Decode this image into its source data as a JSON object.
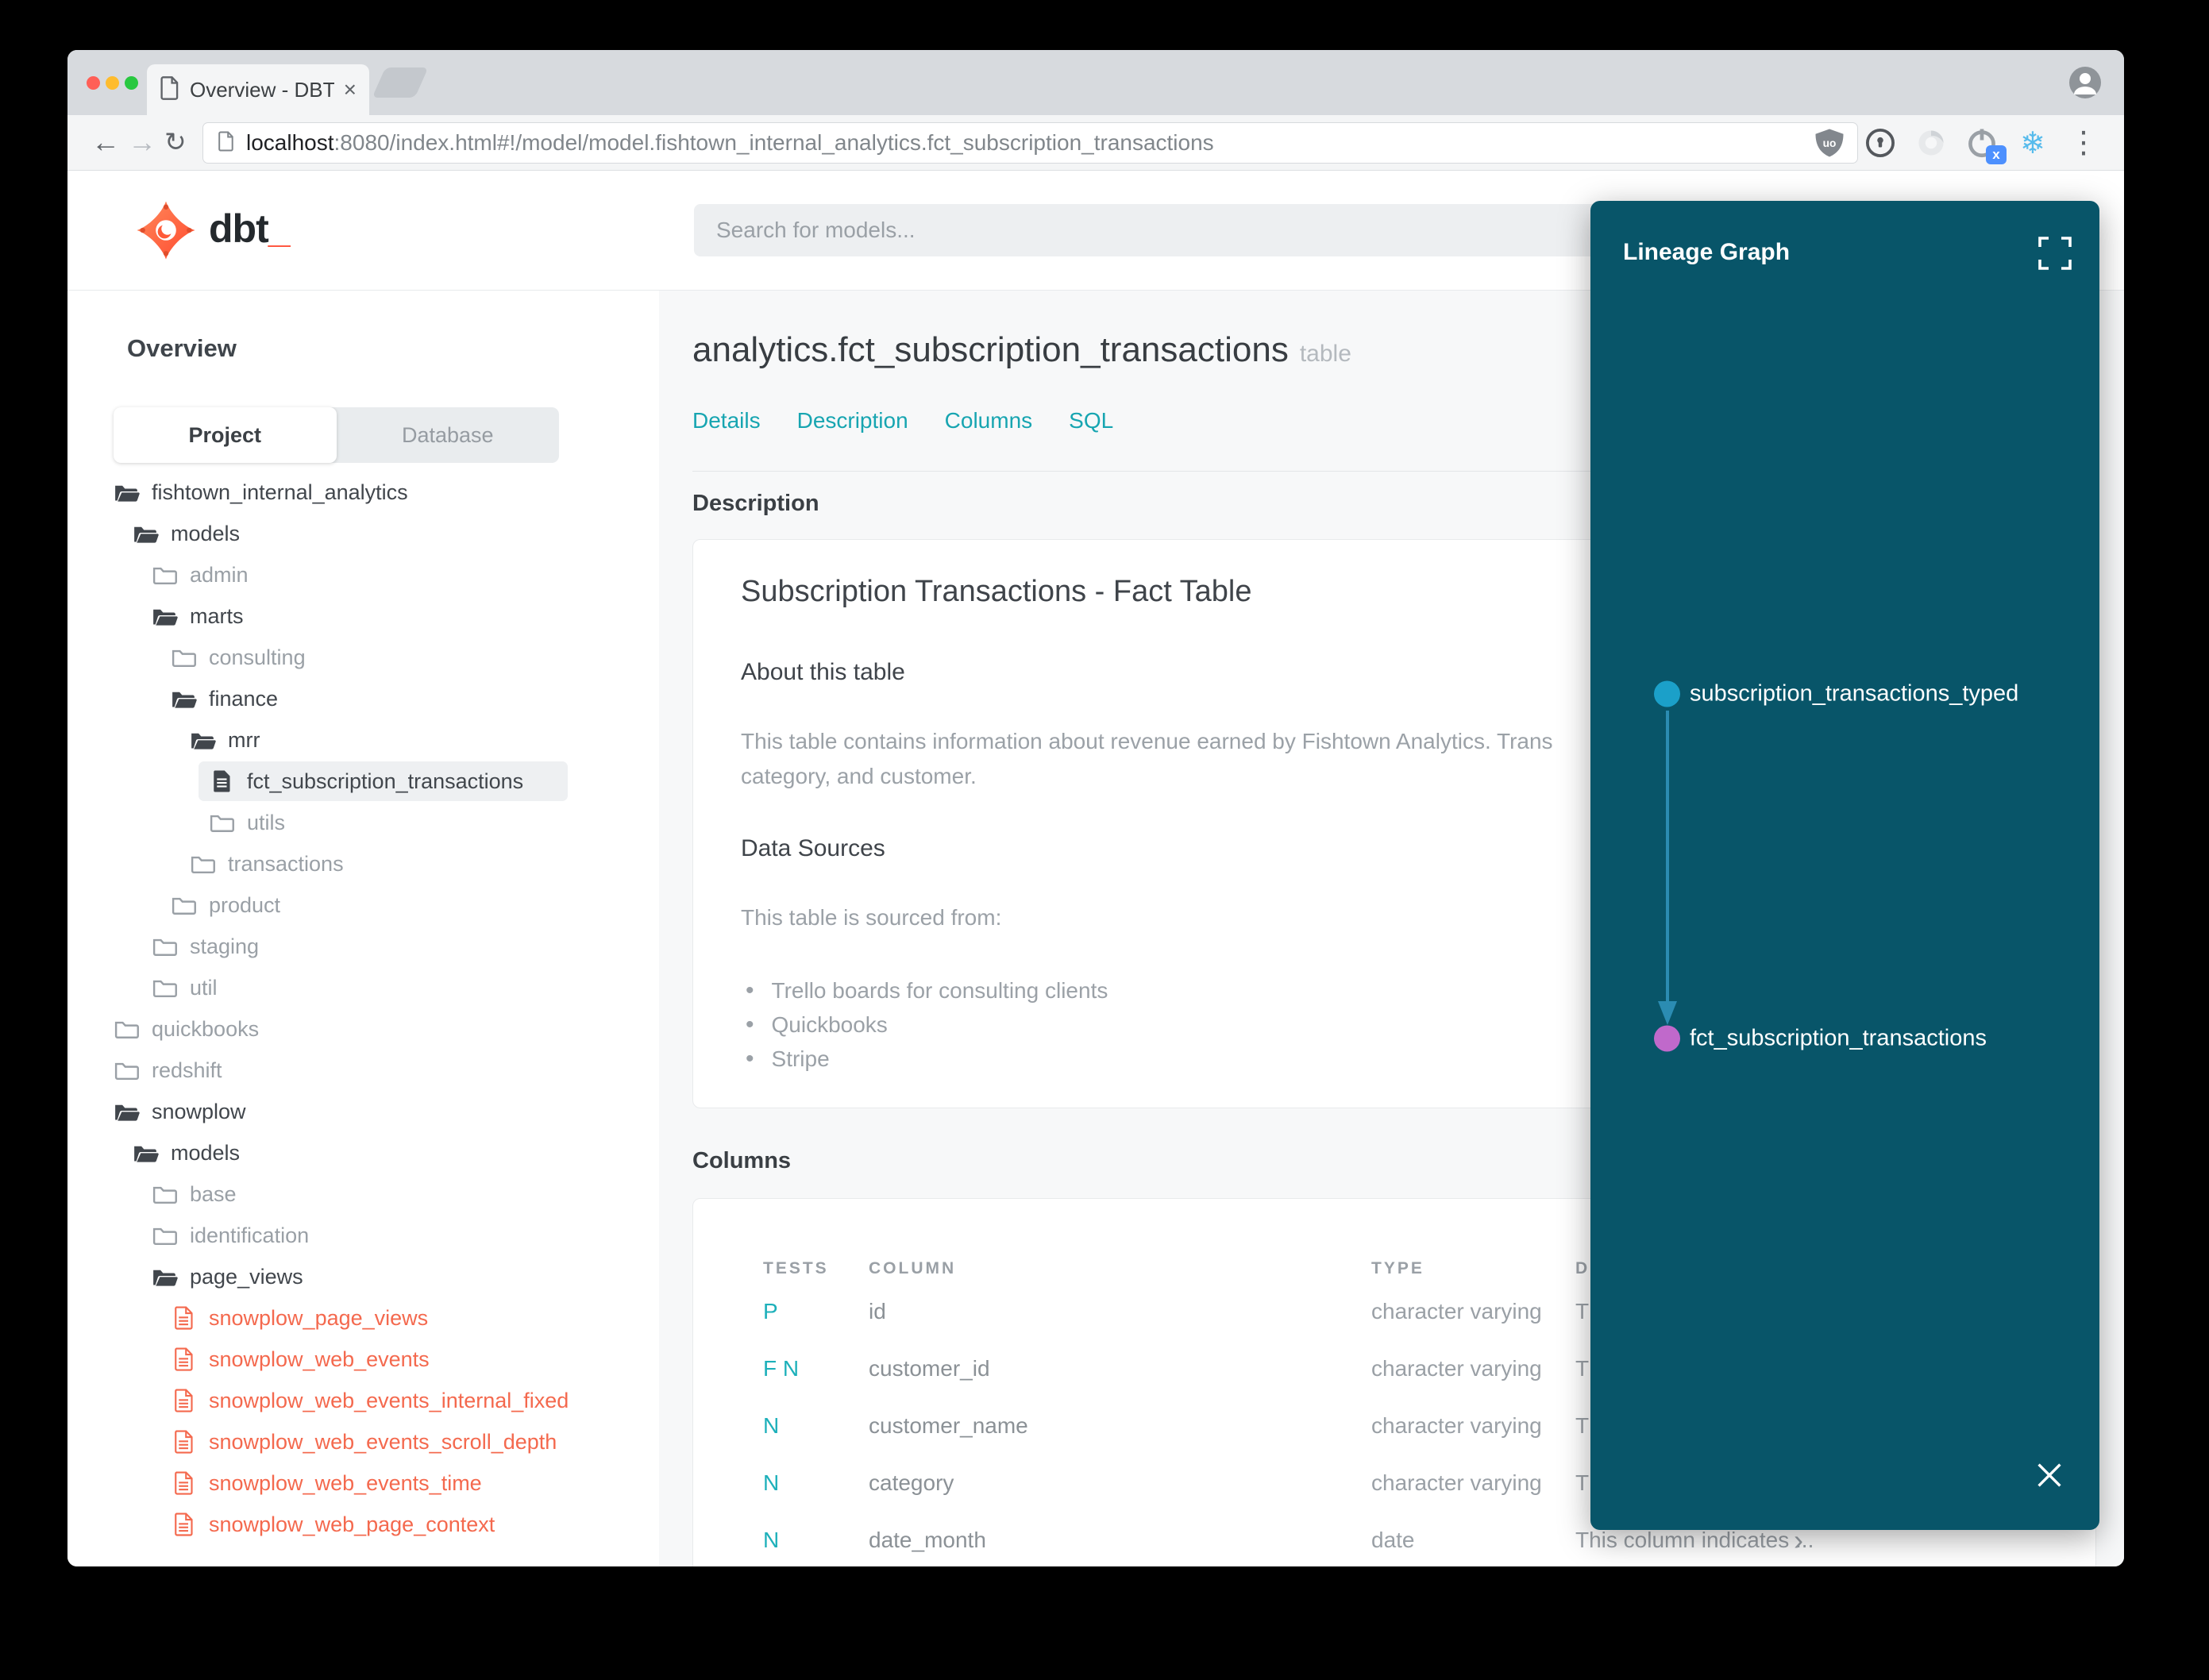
{
  "browser": {
    "tab_title": "Overview - DBT Docs",
    "tab_close": "×",
    "url": {
      "host": "localhost",
      "path": ":8080/index.html#!/model/model.fishtown_internal_analytics.fct_subscription_transactions"
    },
    "nav": {
      "back": "←",
      "forward": "→",
      "reload": "↻"
    },
    "extensions": [
      "ublock-origin-icon",
      "1password-icon",
      "extension-disc-icon",
      "power-x-icon",
      "snowflake-icon",
      "browser-menu-icon"
    ],
    "snowflake_glyph": "❄",
    "menu_glyph": "⋮"
  },
  "header": {
    "logo_text": "dbt",
    "logo_cursor": "_",
    "search_placeholder": "Search for models..."
  },
  "sidebar": {
    "title": "Overview",
    "tabs": [
      {
        "label": "Project",
        "active": true
      },
      {
        "label": "Database",
        "active": false
      }
    ],
    "tree": [
      {
        "label": "fishtown_internal_analytics",
        "level": 0,
        "icon": "folder-open",
        "tone": "dark"
      },
      {
        "label": "models",
        "level": 1,
        "icon": "folder-open",
        "tone": "dark"
      },
      {
        "label": "admin",
        "level": 2,
        "icon": "folder-closed",
        "tone": "muted"
      },
      {
        "label": "marts",
        "level": 2,
        "icon": "folder-open",
        "tone": "dark"
      },
      {
        "label": "consulting",
        "level": 3,
        "icon": "folder-closed",
        "tone": "muted"
      },
      {
        "label": "finance",
        "level": 3,
        "icon": "folder-open",
        "tone": "dark"
      },
      {
        "label": "mrr",
        "level": 4,
        "icon": "folder-open",
        "tone": "dark"
      },
      {
        "label": "fct_subscription_transactions",
        "level": 5,
        "icon": "file-solid",
        "tone": "dark",
        "selected": true
      },
      {
        "label": "utils",
        "level": 5,
        "icon": "folder-closed",
        "tone": "muted"
      },
      {
        "label": "transactions",
        "level": 4,
        "icon": "folder-closed",
        "tone": "muted"
      },
      {
        "label": "product",
        "level": 3,
        "icon": "folder-closed",
        "tone": "muted"
      },
      {
        "label": "staging",
        "level": 2,
        "icon": "folder-closed",
        "tone": "muted"
      },
      {
        "label": "util",
        "level": 2,
        "icon": "folder-closed",
        "tone": "muted"
      },
      {
        "label": "quickbooks",
        "level": 0,
        "icon": "folder-closed",
        "tone": "muted"
      },
      {
        "label": "redshift",
        "level": 0,
        "icon": "folder-closed",
        "tone": "muted"
      },
      {
        "label": "snowplow",
        "level": 0,
        "icon": "folder-open",
        "tone": "dark"
      },
      {
        "label": "models",
        "level": 1,
        "icon": "folder-open",
        "tone": "dark"
      },
      {
        "label": "base",
        "level": 2,
        "icon": "folder-closed",
        "tone": "muted"
      },
      {
        "label": "identification",
        "level": 2,
        "icon": "folder-closed",
        "tone": "muted"
      },
      {
        "label": "page_views",
        "level": 2,
        "icon": "folder-open",
        "tone": "dark"
      },
      {
        "label": "snowplow_page_views",
        "level": 3,
        "icon": "file-outline",
        "tone": "accent"
      },
      {
        "label": "snowplow_web_events",
        "level": 3,
        "icon": "file-outline",
        "tone": "accent"
      },
      {
        "label": "snowplow_web_events_internal_fixed",
        "level": 3,
        "icon": "file-outline",
        "tone": "accent"
      },
      {
        "label": "snowplow_web_events_scroll_depth",
        "level": 3,
        "icon": "file-outline",
        "tone": "accent"
      },
      {
        "label": "snowplow_web_events_time",
        "level": 3,
        "icon": "file-outline",
        "tone": "accent"
      },
      {
        "label": "snowplow_web_page_context",
        "level": 3,
        "icon": "file-outline",
        "tone": "accent"
      }
    ]
  },
  "model": {
    "name": "analytics.fct_subscription_transactions",
    "badge": "table",
    "tabs": [
      "Details",
      "Description",
      "Columns",
      "SQL"
    ]
  },
  "description_section": {
    "heading": "Description",
    "title": "Subscription Transactions - Fact Table",
    "about_heading": "About this table",
    "about_lines": [
      "This table contains information about revenue earned by Fishtown Analytics. Trans",
      "category, and customer."
    ],
    "sources_heading": "Data Sources",
    "sources_intro": "This table is sourced from:",
    "sources": [
      "Trello boards for consulting clients",
      "Quickbooks",
      "Stripe"
    ]
  },
  "columns_section": {
    "heading": "Columns",
    "table": {
      "headers": [
        "TESTS",
        "COLUMN",
        "TYPE",
        "DESCRIPTION"
      ],
      "rows": [
        {
          "tests": "P",
          "column": "id",
          "type": "character varying",
          "description": "T"
        },
        {
          "tests": "F N",
          "column": "customer_id",
          "type": "character varying",
          "description": "T"
        },
        {
          "tests": "N",
          "column": "customer_name",
          "type": "character varying",
          "description": "T"
        },
        {
          "tests": "N",
          "column": "category",
          "type": "character varying",
          "description": "T"
        },
        {
          "tests": "N",
          "column": "date_month",
          "type": "date",
          "description": "This column indicates ...",
          "expandable": true
        }
      ]
    }
  },
  "lineage": {
    "title": "Lineage Graph",
    "panel_color": "#085569",
    "nodes": [
      {
        "label": "subscription_transactions_typed",
        "color": "#1ba0c9"
      },
      {
        "label": "fct_subscription_transactions",
        "color": "#c069cb"
      }
    ]
  },
  "colors": {
    "accent_teal": "#17a5b1",
    "accent_orange": "#f4694e",
    "test_badge_teal": "#1db0ba"
  }
}
